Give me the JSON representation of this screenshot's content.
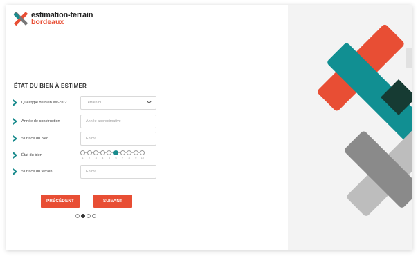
{
  "brand": {
    "name_line1": "estimation-terrain",
    "name_line2": "bordeaux",
    "colors": {
      "accent": "#e84e34",
      "teal": "#1a8b8d",
      "dark": "#222222"
    }
  },
  "form": {
    "title": "ÉTAT DU BIEN À ESTIMER",
    "fields": [
      {
        "label": "Quel type de bien est-ce ?",
        "placeholder": "Terrain nu",
        "kind": "select"
      },
      {
        "label": "Année de construction",
        "placeholder": "Année approximative",
        "kind": "text"
      },
      {
        "label": "Surface du bien",
        "placeholder": "En m²",
        "kind": "text"
      },
      {
        "label": "État du bien",
        "kind": "rating",
        "selected": 6,
        "scale": [
          "1",
          "2",
          "3",
          "4",
          "5",
          "6",
          "7",
          "8",
          "9",
          "10"
        ]
      },
      {
        "label": "Surface du terrain",
        "placeholder": "En m²",
        "kind": "text"
      }
    ]
  },
  "buttons": {
    "prev": "PRÉCÉDENT",
    "next": "SUIVANT"
  },
  "pagination": {
    "current": 2,
    "total": 4
  },
  "icons": [
    "logo-x-icon",
    "chevron-right-icon",
    "chevron-down-icon"
  ]
}
